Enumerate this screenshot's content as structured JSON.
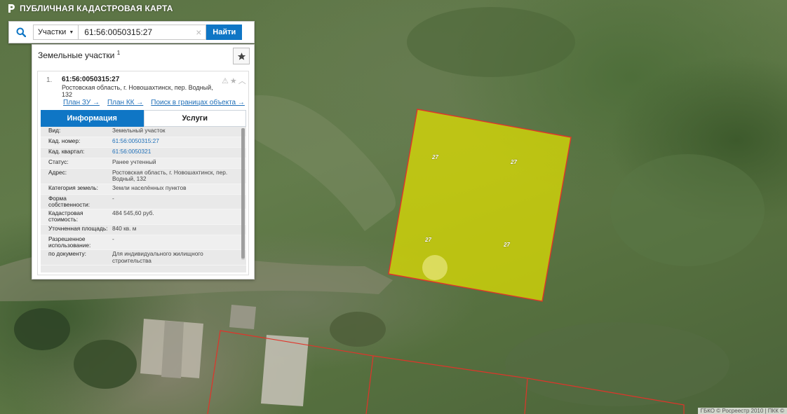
{
  "header": {
    "title": "ПУБЛИЧНАЯ КАДАСТРОВАЯ КАРТА"
  },
  "search": {
    "type_label": "Участки",
    "query": "61:56:0050315:27",
    "clear_glyph": "×",
    "find_label": "Найти"
  },
  "panel": {
    "title": "Земельные участки",
    "count": "1",
    "result": {
      "number": "1.",
      "id": "61:56:0050315:27",
      "address": "Ростовская область, г. Новошахтинск, пер. Водный, 132",
      "links": [
        "План ЗУ →",
        "План КК →",
        "Поиск в границах объекта →"
      ]
    },
    "tabs": [
      "Информация",
      "Услуги"
    ],
    "rows": [
      {
        "key": "Вид:",
        "value": "Земельный участок"
      },
      {
        "key": "Кад. номер:",
        "value": "61:56:0050315:27"
      },
      {
        "key": "Кад. квартал:",
        "value": "61:56:0050321"
      },
      {
        "key": "Статус:",
        "value": "Ранее учтенный"
      },
      {
        "key": "Адрес:",
        "value": "Ростовская область, г. Новошахтинск, пер. Водный, 132"
      },
      {
        "key": "Категория земель:",
        "value": "Земли населённых пунктов"
      },
      {
        "key": "Форма собственности:",
        "value": "-"
      },
      {
        "key": "Кадастровая стоимость:",
        "value": "484 545,60 руб."
      },
      {
        "key": "Уточненная площадь:",
        "value": "840 кв. м"
      },
      {
        "key": "Разрешенное использование:",
        "value": "-"
      },
      {
        "key": "по документу:",
        "value": "Для индивидуального жилищного строительства"
      }
    ]
  },
  "map": {
    "parcel_labels": [
      "27",
      "27",
      "27",
      "27"
    ],
    "attribution": "ГБКО © Росреестр 2010 | ПКК ©"
  },
  "colors": {
    "accent": "#0f76c5",
    "parcel_fill": "#e0e000",
    "parcel_border": "#e0342a",
    "link": "#1f6fb8"
  },
  "icons": [
    "logo-icon",
    "search-icon",
    "chevron-down-icon",
    "close-icon",
    "star-icon",
    "warning-icon",
    "collapse-icon"
  ]
}
